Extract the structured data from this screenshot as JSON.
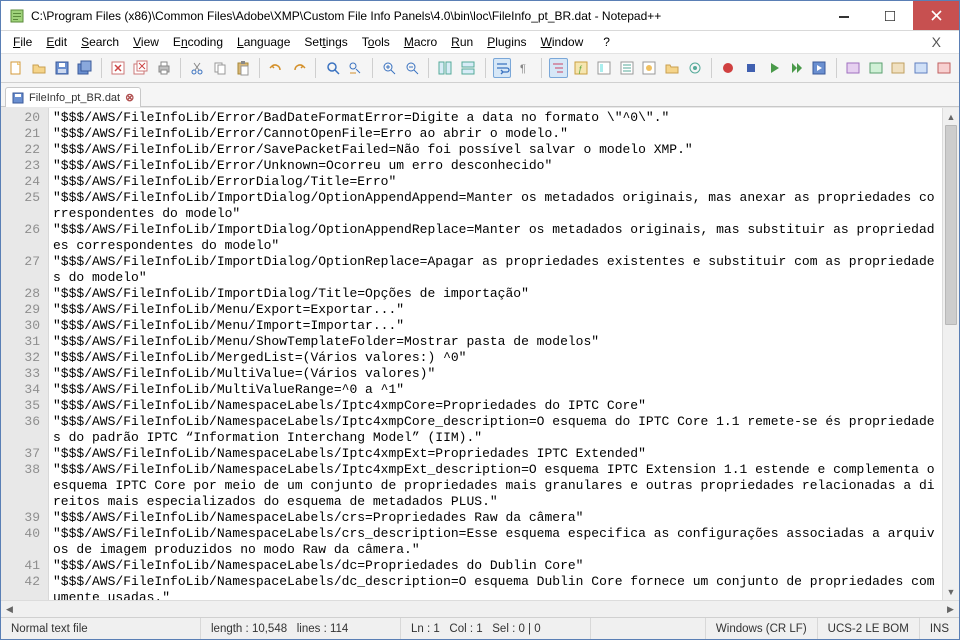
{
  "titlebar": {
    "title": "C:\\Program Files (x86)\\Common Files\\Adobe\\XMP\\Custom File Info Panels\\4.0\\bin\\loc\\FileInfo_pt_BR.dat - Notepad++"
  },
  "menu": {
    "file": "File",
    "edit": "Edit",
    "search": "Search",
    "view": "View",
    "encoding": "Encoding",
    "language": "Language",
    "settings": "Settings",
    "tools": "Tools",
    "macro": "Macro",
    "run": "Run",
    "plugins": "Plugins",
    "window": "Window",
    "help": "?",
    "close_x": "X"
  },
  "tab": {
    "label": "FileInfo_pt_BR.dat"
  },
  "gutter_start": 20,
  "lines": [
    "\"$$$/AWS/FileInfoLib/Error/BadDateFormatError=Digite a data no formato \\\"^0\\\".\"",
    "\"$$$/AWS/FileInfoLib/Error/CannotOpenFile=Erro ao abrir o modelo.\"",
    "\"$$$/AWS/FileInfoLib/Error/SavePacketFailed=Não foi possível salvar o modelo XMP.\"",
    "\"$$$/AWS/FileInfoLib/Error/Unknown=Ocorreu um erro desconhecido\"",
    "\"$$$/AWS/FileInfoLib/ErrorDialog/Title=Erro\"",
    "\"$$$/AWS/FileInfoLib/ImportDialog/OptionAppendAppend=Manter os metadados originais, mas anexar as propriedades correspondentes do modelo\"",
    "\"$$$/AWS/FileInfoLib/ImportDialog/OptionAppendReplace=Manter os metadados originais, mas substituir as propriedades correspondentes do modelo\"",
    "\"$$$/AWS/FileInfoLib/ImportDialog/OptionReplace=Apagar as propriedades existentes e substituir com as propriedades do modelo\"",
    "\"$$$/AWS/FileInfoLib/ImportDialog/Title=Opções de importação\"",
    "\"$$$/AWS/FileInfoLib/Menu/Export=Exportar...\"",
    "\"$$$/AWS/FileInfoLib/Menu/Import=Importar...\"",
    "\"$$$/AWS/FileInfoLib/Menu/ShowTemplateFolder=Mostrar pasta de modelos\"",
    "\"$$$/AWS/FileInfoLib/MergedList=(Vários valores:) ^0\"",
    "\"$$$/AWS/FileInfoLib/MultiValue=(Vários valores)\"",
    "\"$$$/AWS/FileInfoLib/MultiValueRange=^0 a ^1\"",
    "\"$$$/AWS/FileInfoLib/NamespaceLabels/Iptc4xmpCore=Propriedades do IPTC Core\"",
    "\"$$$/AWS/FileInfoLib/NamespaceLabels/Iptc4xmpCore_description=O esquema do IPTC Core 1.1 remete-se és propriedades do padrão IPTC “Information Interchang Model” (IIM).\"",
    "\"$$$/AWS/FileInfoLib/NamespaceLabels/Iptc4xmpExt=Propriedades IPTC Extended\"",
    "\"$$$/AWS/FileInfoLib/NamespaceLabels/Iptc4xmpExt_description=O esquema IPTC Extension 1.1 estende e complementa o esquema IPTC Core por meio de um conjunto de propriedades mais granulares e outras propriedades relacionadas a direitos mais especializados do esquema de metadados PLUS.\"",
    "\"$$$/AWS/FileInfoLib/NamespaceLabels/crs=Propriedades Raw da câmera\"",
    "\"$$$/AWS/FileInfoLib/NamespaceLabels/crs_description=Esse esquema especifica as configurações associadas a arquivos de imagem produzidos no modo Raw da câmera.\"",
    "\"$$$/AWS/FileInfoLib/NamespaceLabels/dc=Propriedades do Dublin Core\"",
    "\"$$$/AWS/FileInfoLib/NamespaceLabels/dc_description=O esquema Dublin Core fornece um conjunto de propriedades comumente usadas.\""
  ],
  "status": {
    "filetype": "Normal text file",
    "length_label": "length :",
    "length_value": "10,548",
    "lines_label": "lines :",
    "lines_value": "114",
    "ln_label": "Ln :",
    "ln_value": "1",
    "col_label": "Col :",
    "col_value": "1",
    "sel_label": "Sel :",
    "sel_value": "0 | 0",
    "eol": "Windows (CR LF)",
    "encoding": "UCS-2 LE BOM",
    "mode": "INS"
  }
}
